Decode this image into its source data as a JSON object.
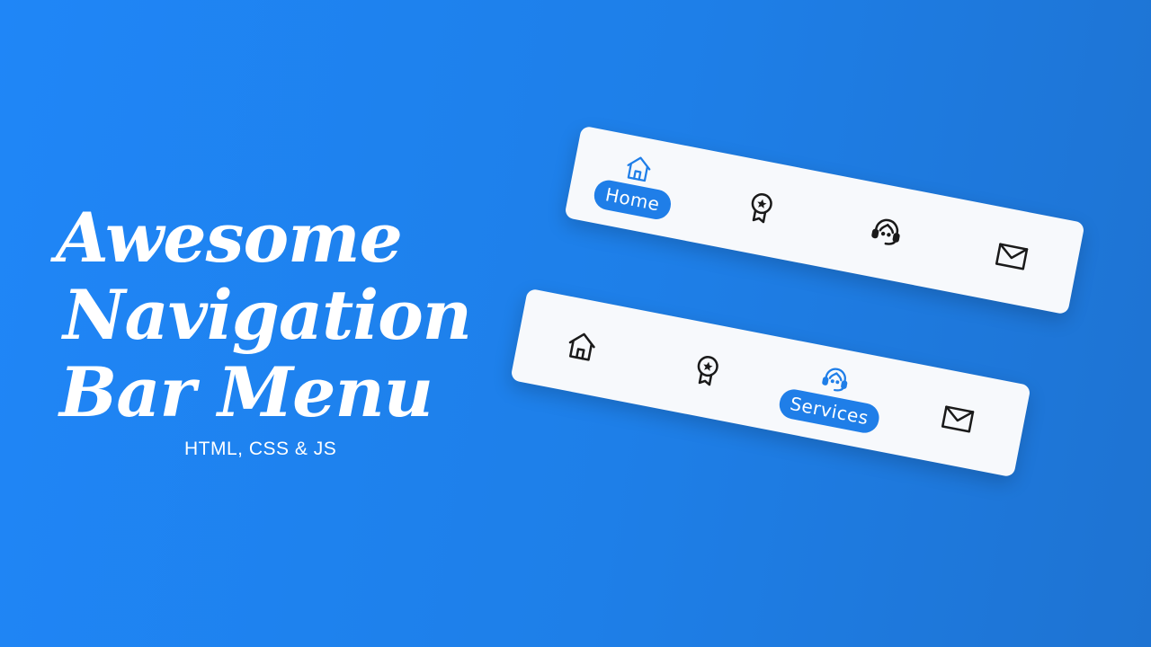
{
  "title": {
    "line1": "Awesome",
    "line2": "Navigation",
    "line3": "Bar Menu",
    "subtitle": "HTML, CSS & JS"
  },
  "colors": {
    "background": "#1f86f7",
    "accent": "#1f7ee8",
    "icon": "#1a1a1a",
    "bar": "#f7f9fc"
  },
  "navbars": [
    {
      "active_index": 0,
      "items": [
        {
          "label": "Home",
          "icon": "home-icon"
        },
        {
          "label": "",
          "icon": "award-icon"
        },
        {
          "label": "",
          "icon": "headset-icon"
        },
        {
          "label": "",
          "icon": "mail-icon"
        }
      ]
    },
    {
      "active_index": 2,
      "items": [
        {
          "label": "",
          "icon": "home-icon"
        },
        {
          "label": "",
          "icon": "award-icon"
        },
        {
          "label": "Services",
          "icon": "headset-icon"
        },
        {
          "label": "",
          "icon": "mail-icon"
        }
      ]
    }
  ]
}
